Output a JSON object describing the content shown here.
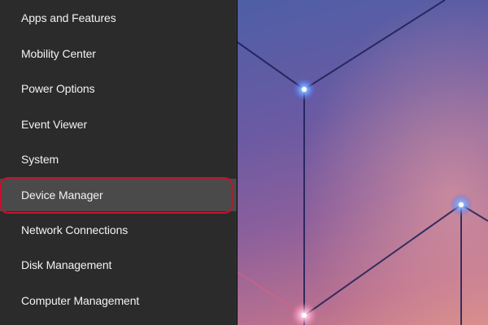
{
  "menu": {
    "items": [
      {
        "label": "Apps and Features"
      },
      {
        "label": "Mobility Center"
      },
      {
        "label": "Power Options"
      },
      {
        "label": "Event Viewer"
      },
      {
        "label": "System"
      },
      {
        "label": "Device Manager",
        "selected": true
      },
      {
        "label": "Network Connections"
      },
      {
        "label": "Disk Management"
      },
      {
        "label": "Computer Management"
      }
    ]
  },
  "colors": {
    "menu_background": "#2b2b2b",
    "menu_text": "#f2f2f2",
    "selection_background": "#4a4a4a",
    "highlight_ring": "#c8102e"
  }
}
